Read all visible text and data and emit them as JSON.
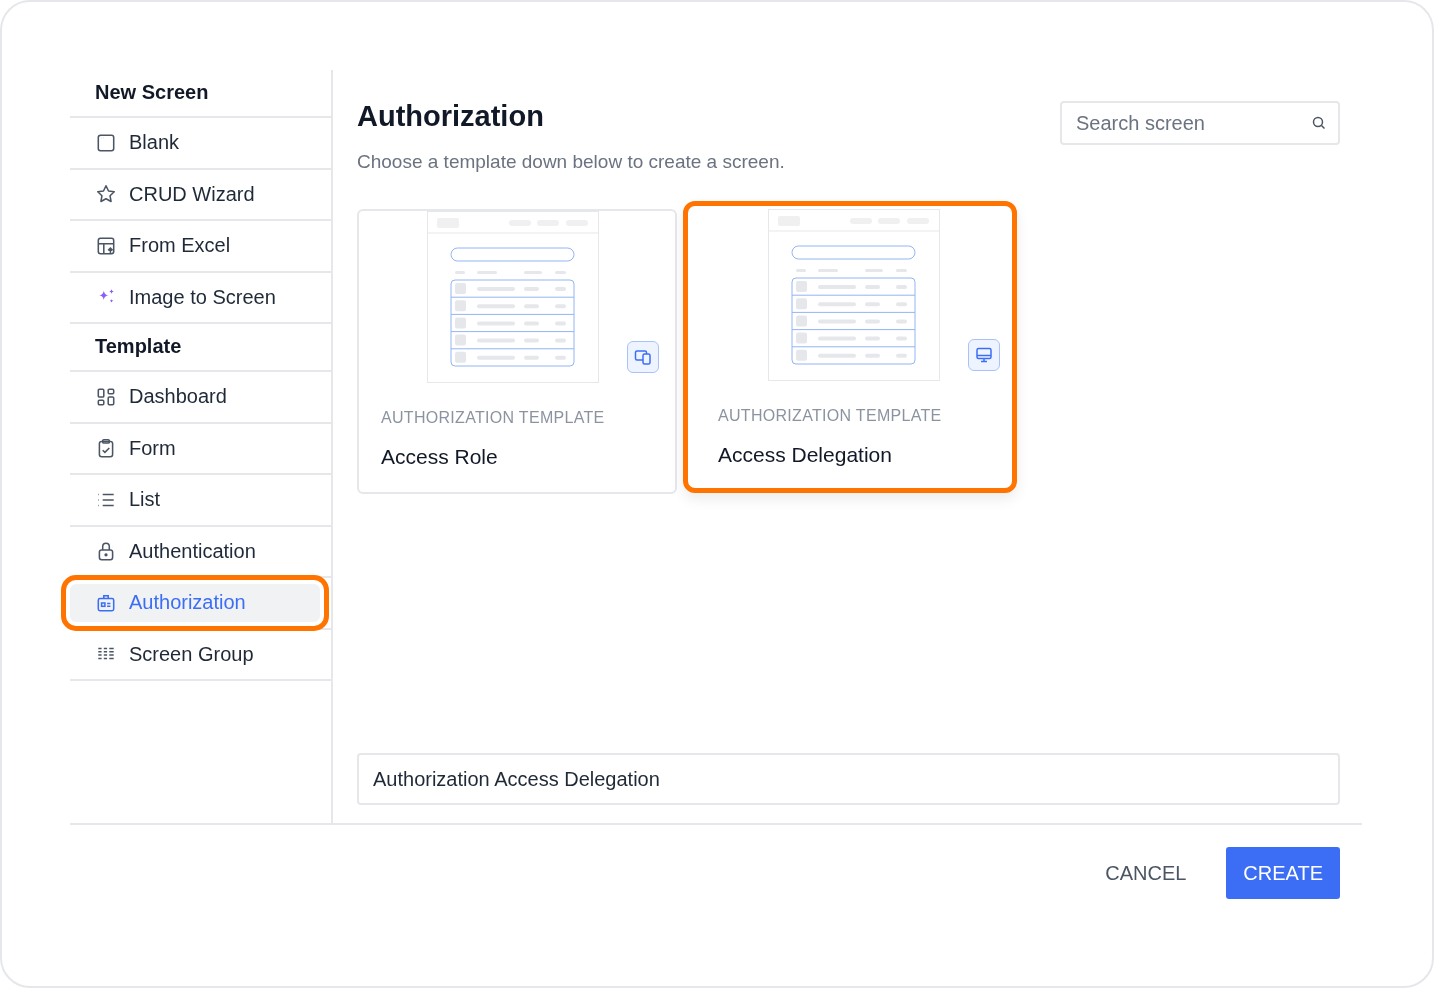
{
  "sidebar": {
    "items": [
      {
        "kind": "heading",
        "label": "New Screen"
      },
      {
        "kind": "item",
        "label": "Blank",
        "selected": false
      },
      {
        "kind": "item",
        "label": "CRUD Wizard",
        "selected": false
      },
      {
        "kind": "item",
        "label": "From Excel",
        "selected": false
      },
      {
        "kind": "item",
        "label": "Image to Screen",
        "selected": false
      },
      {
        "kind": "heading",
        "label": "Template"
      },
      {
        "kind": "item",
        "label": "Dashboard",
        "selected": false
      },
      {
        "kind": "item",
        "label": "Form",
        "selected": false
      },
      {
        "kind": "item",
        "label": "List",
        "selected": false
      },
      {
        "kind": "item",
        "label": "Authentication",
        "selected": false
      },
      {
        "kind": "item",
        "label": "Authorization",
        "selected": true
      },
      {
        "kind": "item",
        "label": "Screen Group",
        "selected": false
      }
    ]
  },
  "main": {
    "title": "Authorization",
    "subtitle": "Choose a template down below to create a screen.",
    "search": {
      "placeholder": "Search screen"
    },
    "cards": [
      {
        "category": "AUTHORIZATION TEMPLATE",
        "name": "Access Role",
        "selected": false
      },
      {
        "category": "AUTHORIZATION TEMPLATE",
        "name": "Access Delegation",
        "selected": true
      }
    ],
    "name_field": {
      "value": "Authorization Access Delegation"
    }
  },
  "buttons": {
    "cancel": "CANCEL",
    "create": "CREATE"
  }
}
